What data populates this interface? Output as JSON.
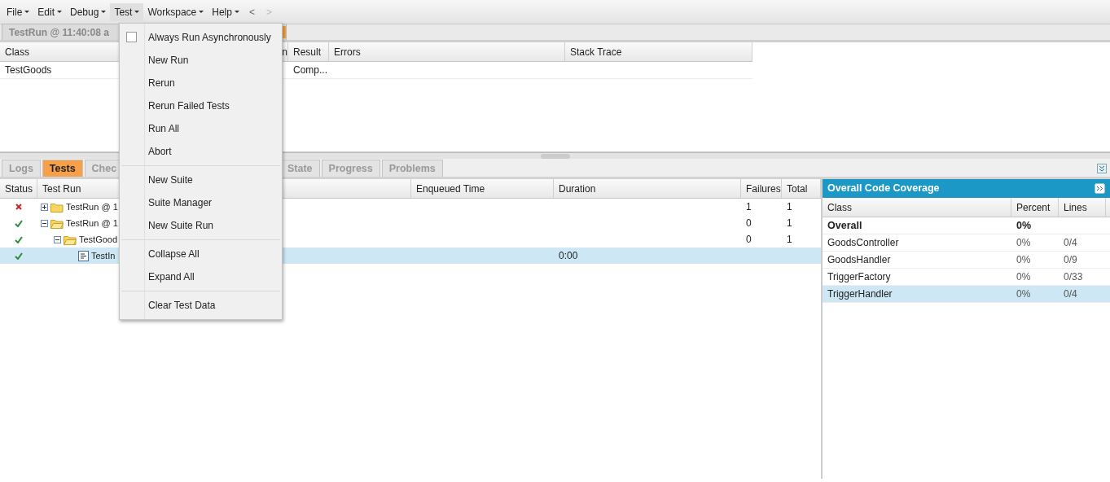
{
  "menu_bar": {
    "items": [
      {
        "label": "File",
        "open": false
      },
      {
        "label": "Edit",
        "open": false
      },
      {
        "label": "Debug",
        "open": false
      },
      {
        "label": "Test",
        "open": true
      },
      {
        "label": "Workspace",
        "open": false
      },
      {
        "label": "Help",
        "open": false
      }
    ],
    "nav": [
      {
        "label": "<",
        "disabled": false
      },
      {
        "label": ">",
        "disabled": true
      }
    ]
  },
  "editor_tabs": [
    {
      "label": "TestRun @ 11:40:08 a"
    }
  ],
  "classes_grid": {
    "columns": [
      "Class",
      "n",
      "Result",
      "Errors",
      "Stack Trace"
    ],
    "rows": [
      {
        "class": "TestGoods",
        "result": "Comp..."
      }
    ]
  },
  "panel_tabs": [
    {
      "label": "Logs",
      "selected": false
    },
    {
      "label": "Tests",
      "selected": true
    },
    {
      "label": "Chec",
      "selected": false
    },
    {
      "label": "State",
      "selected": false
    },
    {
      "label": "Progress",
      "selected": false
    },
    {
      "label": "Problems",
      "selected": false
    }
  ],
  "tests_grid": {
    "columns": [
      "Status",
      "Test Run",
      "Enqueued Time",
      "Duration",
      "Failures",
      "Total"
    ],
    "rows": [
      {
        "failed": true,
        "kind": "folder",
        "name": "TestRun @ 1",
        "expanded": false,
        "failures": "1",
        "total": "1",
        "selected": false
      },
      {
        "failed": false,
        "kind": "folder",
        "name": "TestRun @ 1",
        "expanded": true,
        "failures": "0",
        "total": "1",
        "selected": false,
        "children": [
          {
            "failed": false,
            "kind": "folder",
            "name": "TestGood",
            "expanded": true,
            "failures": "0",
            "total": "1",
            "selected": false,
            "children": [
              {
                "failed": false,
                "kind": "method",
                "name": "TestIn",
                "duration": "0:00",
                "selected": true
              }
            ]
          }
        ]
      }
    ]
  },
  "coverage": {
    "title": "Overall Code Coverage",
    "columns": [
      "Class",
      "Percent",
      "Lines"
    ],
    "rows": [
      {
        "kind": "total",
        "class": "Overall",
        "percent": "0%",
        "selected": false
      },
      {
        "kind": "class",
        "class": "GoodsController",
        "percent": "0%",
        "lines": "0/4",
        "selected": false
      },
      {
        "kind": "class",
        "class": "GoodsHandler",
        "percent": "0%",
        "lines": "0/9",
        "selected": false
      },
      {
        "kind": "class",
        "class": "TriggerFactory",
        "percent": "0%",
        "lines": "0/33",
        "selected": false
      },
      {
        "kind": "class",
        "class": "TriggerHandler",
        "percent": "0%",
        "lines": "0/4",
        "selected": true
      }
    ]
  },
  "test_menu": {
    "items": [
      {
        "kind": "checkbox",
        "label": "Always Run Asynchronously",
        "checked": false
      },
      {
        "kind": "item",
        "label": "New Run"
      },
      {
        "kind": "item",
        "label": "Rerun"
      },
      {
        "kind": "item",
        "label": "Rerun Failed Tests"
      },
      {
        "kind": "item",
        "label": "Run All"
      },
      {
        "kind": "item",
        "label": "Abort"
      },
      {
        "kind": "separator"
      },
      {
        "kind": "item",
        "label": "New Suite"
      },
      {
        "kind": "item",
        "label": "Suite Manager"
      },
      {
        "kind": "item",
        "label": "New Suite Run"
      },
      {
        "kind": "separator"
      },
      {
        "kind": "item",
        "label": "Collapse All"
      },
      {
        "kind": "item",
        "label": "Expand All"
      },
      {
        "kind": "separator"
      },
      {
        "kind": "item",
        "label": "Clear Test Data"
      }
    ]
  }
}
